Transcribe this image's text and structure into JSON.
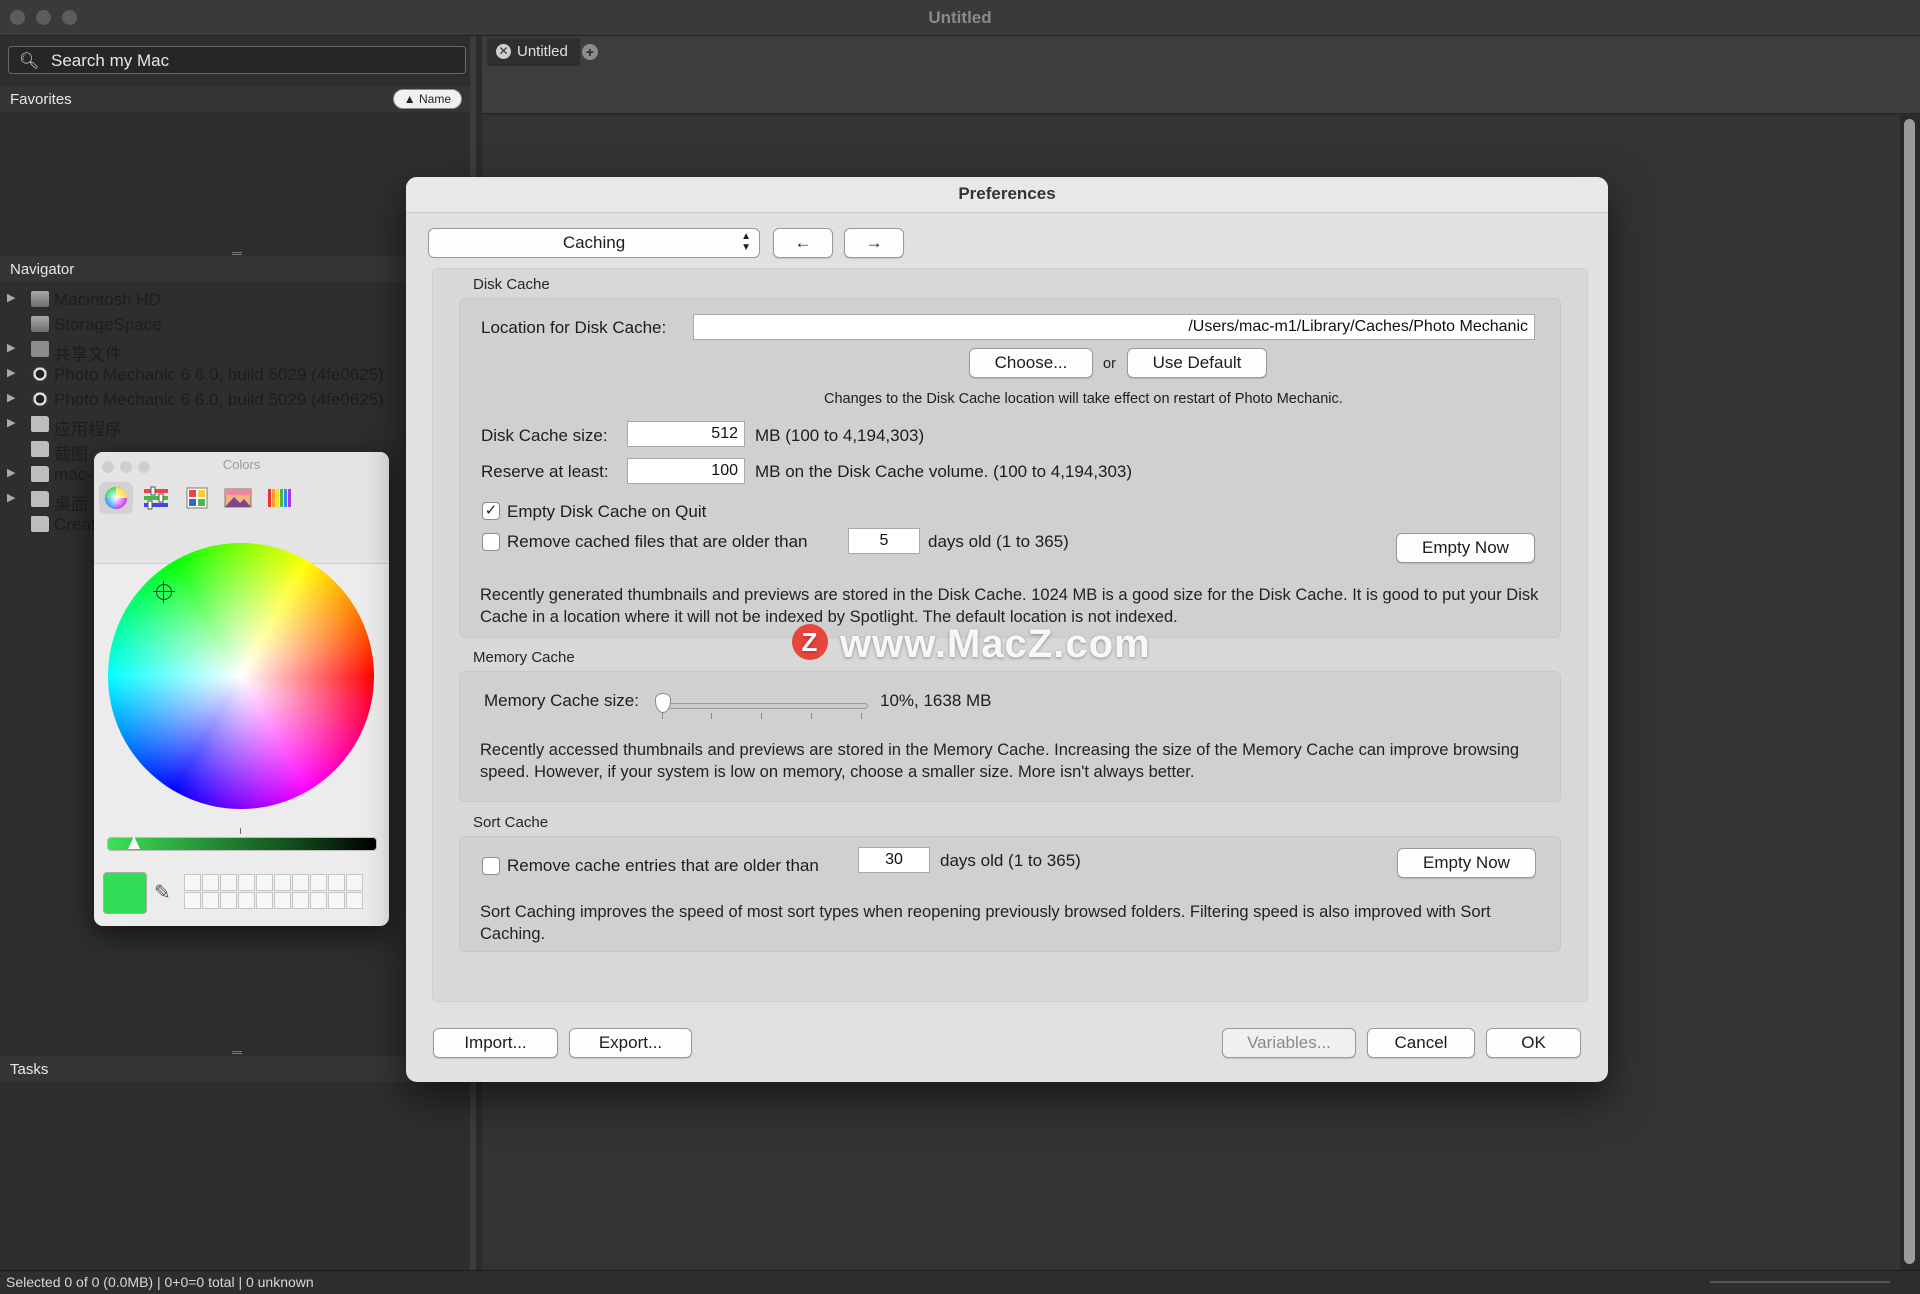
{
  "window": {
    "title": "Untitled"
  },
  "sidebar": {
    "search_placeholder": "Search my Mac",
    "favorites_label": "Favorites",
    "sort_label": "▲ Name",
    "navigator_label": "Navigator",
    "tasks_label": "Tasks",
    "items": [
      {
        "label": "Macintosh HD",
        "icon": "disk-icon"
      },
      {
        "label": "StorageSpace",
        "icon": "disk-icon"
      },
      {
        "label": "共享文件",
        "icon": "folder-icon"
      },
      {
        "label": "Photo Mechanic 6 6.0, build 5029 (4fe0625)",
        "icon": "camera-icon"
      },
      {
        "label": "Photo Mechanic 6 6.0, build 5029 (4fe0625)",
        "icon": "camera-icon"
      },
      {
        "label": "应用程序",
        "icon": "folder-icon"
      },
      {
        "label": "截图",
        "icon": "folder-icon"
      },
      {
        "label": "mac-",
        "icon": "folder-icon"
      },
      {
        "label": "桌面",
        "icon": "folder-icon"
      },
      {
        "label": "Creat",
        "icon": "folder-icon"
      }
    ]
  },
  "tabs": [
    {
      "label": "Untitled"
    }
  ],
  "colors_panel": {
    "title": "Colors",
    "selected_color": "#2fdd57",
    "modes": [
      "color-wheel-icon",
      "sliders-icon",
      "palettes-icon",
      "image-palette-icon",
      "pencils-icon"
    ]
  },
  "dialog": {
    "title": "Preferences",
    "category": "Caching",
    "back_label": "←",
    "forward_label": "→",
    "disk_cache": {
      "header": "Disk Cache",
      "location_label": "Location for Disk Cache:",
      "location_value": "/Users/mac-m1/Library/Caches/Photo Mechanic",
      "choose_label": "Choose...",
      "or_label": "or",
      "use_default_label": "Use Default",
      "restart_note": "Changes to the Disk Cache location will take effect on restart of Photo Mechanic.",
      "size_label": "Disk Cache size:",
      "size_value": "512",
      "size_hint": "MB (100 to 4,194,303)",
      "reserve_label": "Reserve at least:",
      "reserve_value": "100",
      "reserve_hint": "MB on the Disk Cache volume. (100 to 4,194,303)",
      "empty_on_quit_label": "Empty Disk Cache on Quit",
      "empty_on_quit_checked": true,
      "remove_older_label": "Remove cached files that are older than",
      "remove_older_checked": false,
      "days_value": "5",
      "days_hint": "days old (1 to 365)",
      "empty_now_label": "Empty Now",
      "description": "Recently generated thumbnails and previews are stored in the Disk Cache.  1024 MB is a good size for the Disk Cache.  It is good to put your Disk Cache in a location where it will not be indexed by Spotlight.  The default location is not indexed."
    },
    "memory_cache": {
      "header": "Memory Cache",
      "size_label": "Memory Cache size:",
      "size_value": "10%, 1638 MB",
      "slider_fraction": 0.0,
      "description": "Recently accessed thumbnails and previews are stored in the Memory Cache.  Increasing the size of the Memory Cache can improve browsing speed.  However, if your system is low on memory, choose a smaller size.  More isn't always better."
    },
    "sort_cache": {
      "header": "Sort Cache",
      "remove_older_label": "Remove cache entries that are older than",
      "remove_older_checked": false,
      "days_value": "30",
      "days_hint": "days old (1 to 365)",
      "empty_now_label": "Empty Now",
      "description": "Sort Caching improves the speed of most sort types when reopening previously browsed folders.  Filtering speed is also improved with Sort Caching."
    },
    "buttons": {
      "import": "Import...",
      "export": "Export...",
      "variables": "Variables...",
      "cancel": "Cancel",
      "ok": "OK"
    }
  },
  "status_bar": {
    "text": "Selected 0 of 0 (0.0MB) | 0+0=0 total | 0 unknown"
  },
  "watermark": {
    "badge": "Z",
    "text": "www.MacZ.com"
  }
}
